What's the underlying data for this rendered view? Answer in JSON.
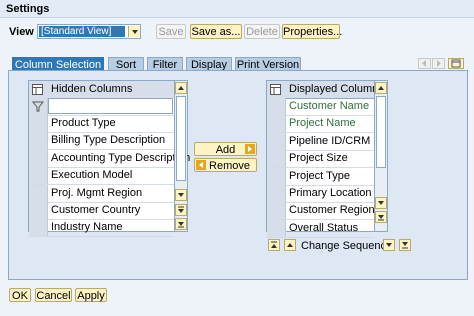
{
  "window": {
    "title": "Settings"
  },
  "view": {
    "label": "View",
    "selected": "[Standard View]"
  },
  "toolbar": {
    "save": "Save",
    "save_as": "Save as...",
    "delete": "Delete",
    "properties": "Properties..."
  },
  "tabs": [
    "Column Selection",
    "Sort",
    "Filter",
    "Display",
    "Print Version"
  ],
  "hidden": {
    "header": "Hidden Columns",
    "filter_value": "",
    "rows": [
      "Product Type",
      "Billing Type Description",
      "Accounting Type Description",
      "Execution Model",
      "Proj. Mgmt Region",
      "Customer Country",
      "Industry Name"
    ]
  },
  "displayed": {
    "header": "Displayed Columns",
    "rows": [
      "Customer Name",
      "Project Name",
      "Pipeline ID/CRM ID",
      "Project Size",
      "Project Type",
      "Primary Location",
      "Customer Region",
      "Overall Status"
    ]
  },
  "actions": {
    "add": "Add",
    "remove": "Remove"
  },
  "sequence": {
    "label": "Change Sequence"
  },
  "footer": {
    "ok": "OK",
    "cancel": "Cancel",
    "apply": "Apply"
  }
}
